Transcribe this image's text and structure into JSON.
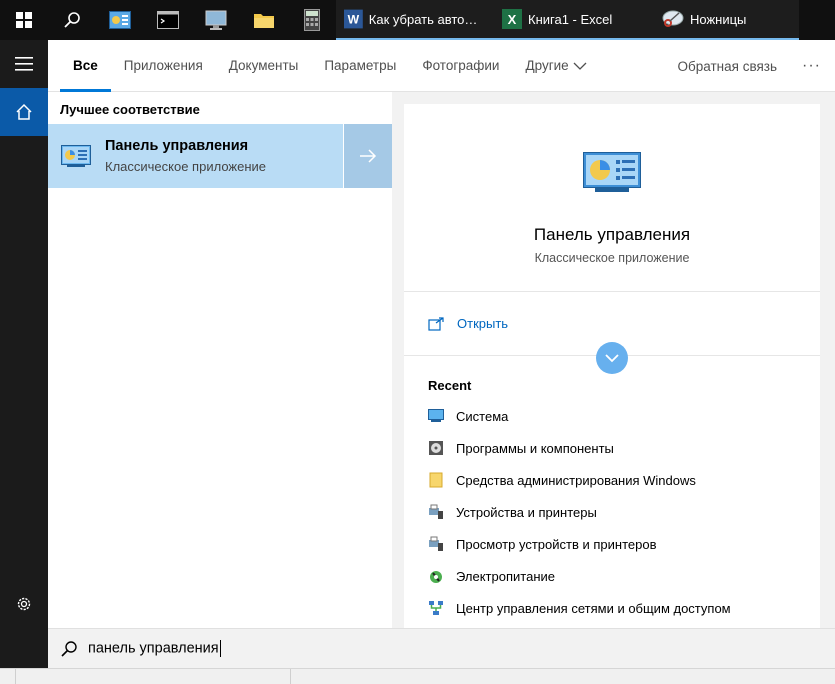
{
  "taskbar": {
    "tasks": [
      {
        "label": "Как убрать автома…",
        "icon": "word-icon",
        "color": "#2b5797"
      },
      {
        "label": "Книга1 - Excel",
        "icon": "excel-icon",
        "color": "#1e7145"
      },
      {
        "label": "Ножницы",
        "icon": "scissors-icon",
        "color": "#c0392b"
      }
    ]
  },
  "tabs": {
    "all": "Все",
    "apps": "Приложения",
    "documents": "Документы",
    "settings": "Параметры",
    "photos": "Фотографии",
    "other": "Другие",
    "feedback": "Обратная связь",
    "more": "···"
  },
  "best_match": {
    "title": "Лучшее соответствие",
    "name": "Панель управления",
    "subtitle": "Классическое приложение"
  },
  "preview": {
    "name": "Панель управления",
    "subtitle": "Классическое приложение",
    "open_label": "Открыть"
  },
  "recent": {
    "title": "Recent",
    "items": [
      {
        "label": "Система",
        "icon": "system-icon"
      },
      {
        "label": "Программы и компоненты",
        "icon": "programs-icon"
      },
      {
        "label": "Средства администрирования Windows",
        "icon": "folder-icon"
      },
      {
        "label": "Устройства и принтеры",
        "icon": "printer-icon"
      },
      {
        "label": "Просмотр устройств и принтеров",
        "icon": "printer-icon"
      },
      {
        "label": "Электропитание",
        "icon": "power-icon"
      },
      {
        "label": "Центр управления сетями и общим доступом",
        "icon": "network-icon"
      }
    ]
  },
  "search": {
    "query": "панель управления"
  },
  "colors": {
    "accent": "#0078d7",
    "selected_bg": "#b9dcf5",
    "link": "#0067c0"
  }
}
